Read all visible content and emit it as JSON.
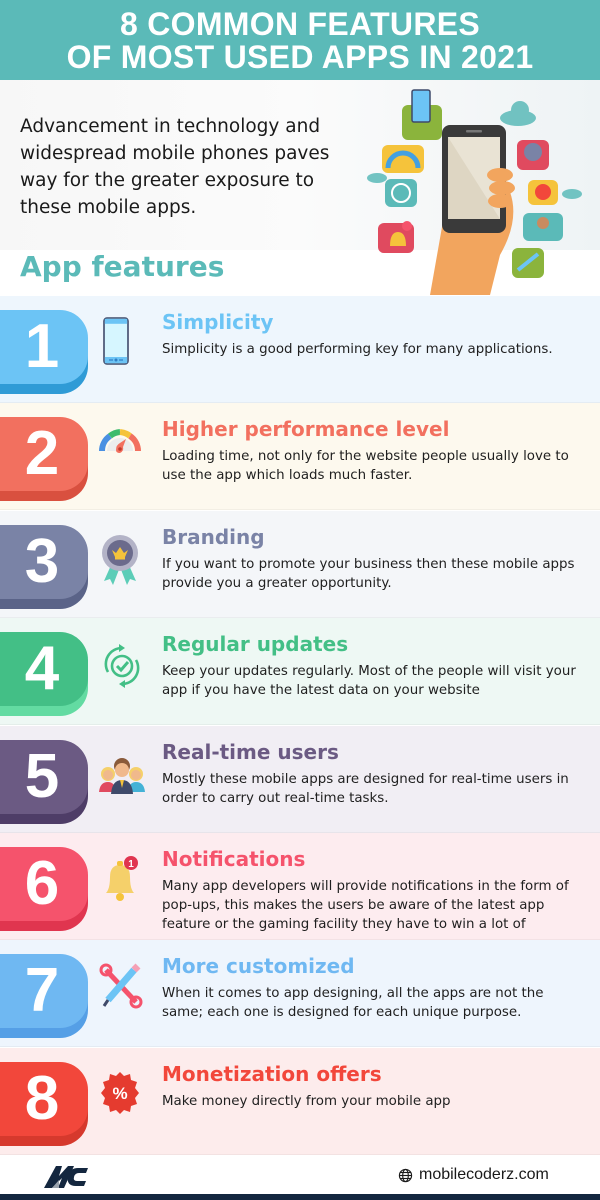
{
  "header": {
    "title_line1": "8 COMMON FEATURES",
    "title_line2": "OF MOST USED APPS IN 2021",
    "background": "#5bbab8"
  },
  "intro": {
    "text": "Advancement in technology and widespread mobile phones paves way for the greater exposure to these mobile apps.",
    "hero_icon": "hand-holding-phone-illustration"
  },
  "section": {
    "title": "App features"
  },
  "features": [
    {
      "number": "1",
      "title": "Simplicity",
      "description": "Simplicity is a good performing key for many applications.",
      "icon": "smartphone-icon",
      "color": "#6cc4f5",
      "shade": "#2f9bd6",
      "bg": "#eef6fd"
    },
    {
      "number": "2",
      "title": "Higher performance level",
      "description": "Loading time, not only for the website people usually love to use the app which loads much faster.",
      "icon": "speedometer-icon",
      "color": "#f2705f",
      "shade": "#d9503f",
      "bg": "#fdf9ee"
    },
    {
      "number": "3",
      "title": "Branding",
      "description": "If you want to promote your business then these mobile apps provide you a greater opportunity.",
      "icon": "award-badge-icon",
      "color": "#7a83a6",
      "shade": "#5a6388",
      "bg": "#f4f6f9"
    },
    {
      "number": "4",
      "title": "Regular updates",
      "description": "Keep your updates regularly. Most of the people will visit your app if you have the latest data on your website",
      "icon": "sync-check-icon",
      "color": "#43bf86",
      "shade": "#63dba2",
      "bg": "#eef8f4"
    },
    {
      "number": "5",
      "title": "Real-time users",
      "description": "Mostly these mobile apps are designed for real-time users in order to carry out real-time tasks.",
      "icon": "users-group-icon",
      "color": "#6b5a83",
      "shade": "#4e3d67",
      "bg": "#f1eef4"
    },
    {
      "number": "6",
      "title": "Notifications",
      "description": "Many app developers will provide notifications in the form of pop-ups, this makes the users be aware of the latest app feature or the gaming facility they have to win a lot of",
      "icon": "notification-bell-icon",
      "color": "#f5536c",
      "shade": "#e0354f",
      "bg": "#fdecef",
      "notification_count": "1"
    },
    {
      "number": "7",
      "title": "More customized",
      "description": "When it comes to app designing, all the apps are not the same; each one is designed for each unique purpose.",
      "icon": "tools-icon",
      "color": "#6fb8f2",
      "shade": "#559fe6",
      "bg": "#eef5fd"
    },
    {
      "number": "8",
      "title": "Monetization offers",
      "description": "Make money directly from your mobile app",
      "icon": "discount-badge-icon",
      "color": "#f2473b",
      "shade": "#d6392d",
      "bg": "#fdecec",
      "badge_symbol": "%"
    }
  ],
  "footer": {
    "logo_text": "MC",
    "website": "mobilecoderz.com",
    "bar_color": "#14273f"
  }
}
